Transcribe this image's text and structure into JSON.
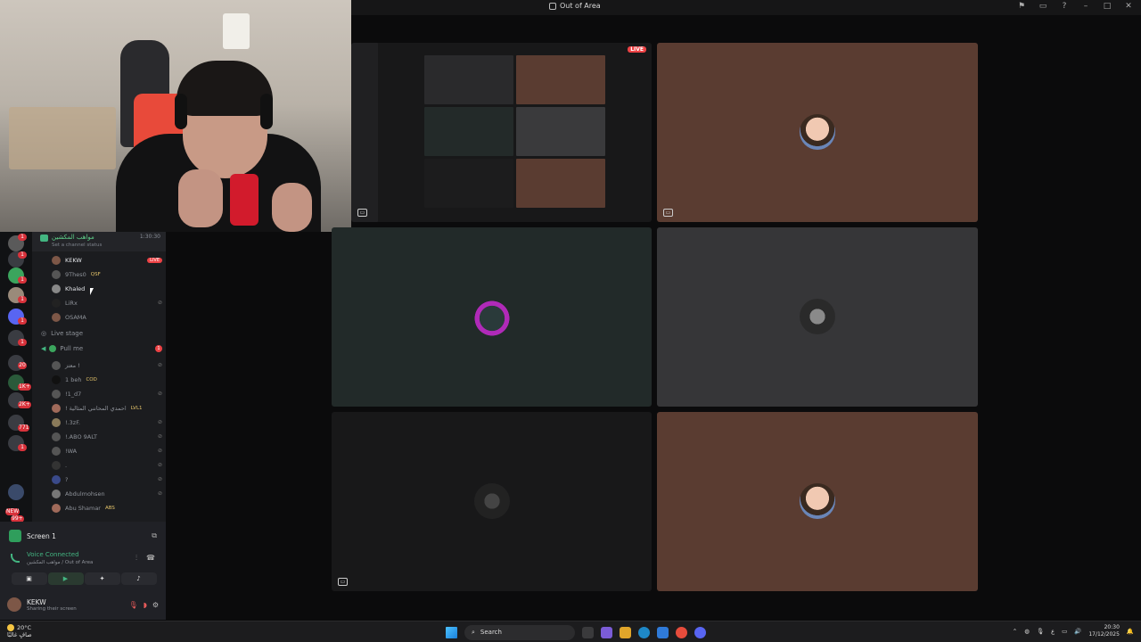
{
  "window": {
    "title": "Out of Area",
    "controls": [
      "flag-icon",
      "screen-icon",
      "help-icon",
      "minimize-icon",
      "maximize-icon",
      "close-icon"
    ]
  },
  "channel": {
    "name": "مواهب المكشين",
    "timer": "1:30:30",
    "status": "Set a channel status"
  },
  "users_top": [
    {
      "name": "KEKW",
      "live": "LIVE",
      "bright": true
    },
    {
      "name": "9Thes0",
      "tag": "QSF"
    },
    {
      "name": "Khaled",
      "bright": true
    },
    {
      "name": "LiRx"
    },
    {
      "name": "OSAMA"
    }
  ],
  "stage": {
    "label": "Live stage"
  },
  "voice_room": {
    "label": "Pull me",
    "count": "1"
  },
  "users_bottom": [
    {
      "name": "معتز !"
    },
    {
      "name": "1 beh",
      "tag": "COD"
    },
    {
      "name": "!1_d7"
    },
    {
      "name": "! احمدي المحانني المثالية",
      "tag": "LVL1"
    },
    {
      "name": "!.3zF."
    },
    {
      "name": "!.ABO 9ALT"
    },
    {
      "name": "!WA"
    },
    {
      "name": "."
    },
    {
      "name": "?"
    },
    {
      "name": "Abdulmohsen"
    },
    {
      "name": "Abu Shamar",
      "tag": "ABS"
    }
  ],
  "guild_badges": [
    "1",
    "1",
    "1",
    "1",
    "1",
    "1",
    "20",
    "1K+",
    "2K+",
    "771",
    "1",
    "NEW",
    "99+"
  ],
  "panel": {
    "screen_label": "Screen 1",
    "voice_status": "Voice Connected",
    "voice_sub": "مواهب المكشين / Out of Area",
    "user_name": "KEKW",
    "user_sub": "Sharing their screen"
  },
  "grid": {
    "live_label": "LIVE"
  },
  "taskbar": {
    "weather_temp": "20°C",
    "weather_desc": "صافٍ غالبًا",
    "search_placeholder": "Search",
    "time": "20:30",
    "date": "17/12/2025",
    "lang": "ع"
  },
  "colors": {
    "accent_green": "#43b581",
    "live_red": "#ed4245",
    "tile_brown": "#5a3c31"
  }
}
